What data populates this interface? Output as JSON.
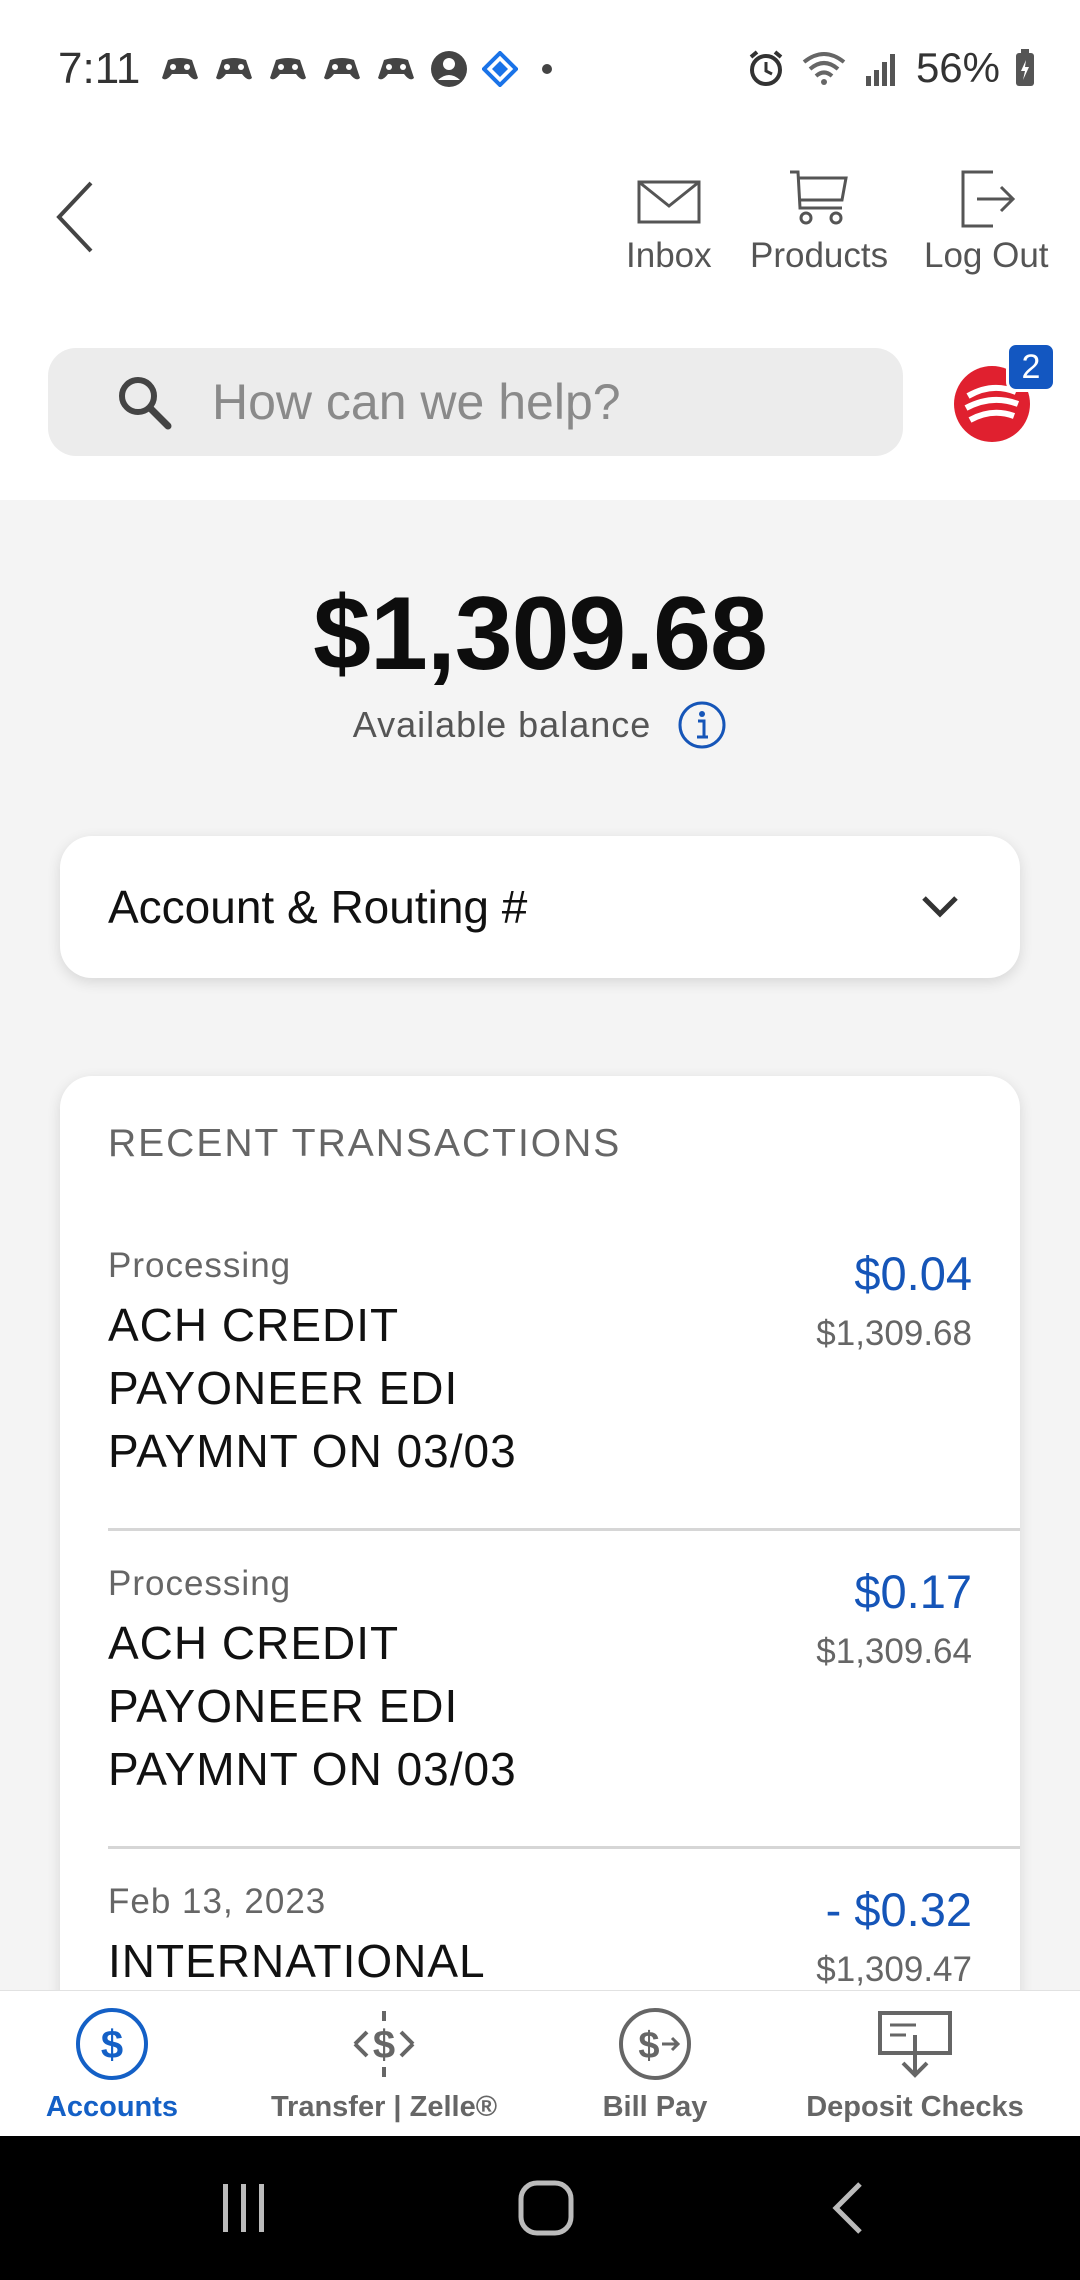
{
  "status_bar": {
    "time": "7:11",
    "battery": "56%"
  },
  "header": {
    "actions": {
      "inbox": "Inbox",
      "products": "Products",
      "logout": "Log Out"
    },
    "search_placeholder": "How can we help?",
    "notification_count": "2"
  },
  "balance": {
    "amount": "$1,309.68",
    "label": "Available balance"
  },
  "routing": {
    "label": "Account & Routing #"
  },
  "transactions": {
    "header": "RECENT TRANSACTIONS",
    "items": [
      {
        "status": "Processing",
        "description": "ACH CREDIT PAYONEER EDI PAYMNT ON 03/03",
        "amount": "$0.04",
        "running_balance": "$1,309.68"
      },
      {
        "status": "Processing",
        "description": "ACH CREDIT PAYONEER EDI PAYMNT ON 03/03",
        "amount": "$0.17",
        "running_balance": "$1,309.64"
      },
      {
        "status": "Feb 13, 2023",
        "description": "INTERNATIONAL",
        "amount": "- $0.32",
        "running_balance": "$1,309.47"
      }
    ]
  },
  "bottom_nav": {
    "accounts": "Accounts",
    "transfer": "Transfer | Zelle®",
    "billpay": "Bill Pay",
    "deposit": "Deposit Checks"
  },
  "colors": {
    "accent": "#1460c6",
    "amount_blue": "#1555b8",
    "logo_red": "#e0202f"
  }
}
